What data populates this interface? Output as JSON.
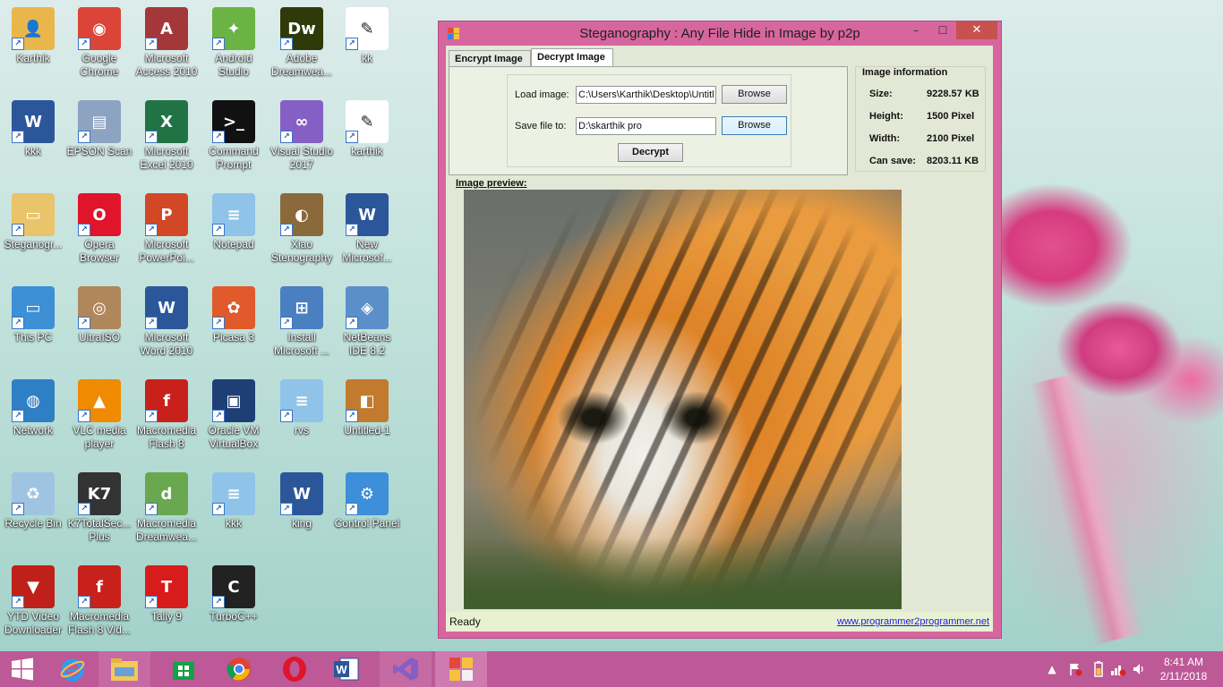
{
  "desktop": {
    "icons": [
      {
        "label": "Karthik",
        "icon": "user-folder-icon",
        "color": "#e9b64b"
      },
      {
        "label": "Google Chrome",
        "icon": "chrome-icon",
        "color": "#db4437"
      },
      {
        "label": "Microsoft Access 2010",
        "icon": "access-icon",
        "color": "#a4373a"
      },
      {
        "label": "Android Studio",
        "icon": "android-studio-icon",
        "color": "#6ab344"
      },
      {
        "label": "Adobe Dreamwea...",
        "icon": "dreamweaver-icon",
        "color": "#2f3a0a"
      },
      {
        "label": "kk",
        "icon": "image-file-icon",
        "color": "#ffffff"
      },
      {
        "label": "kkk",
        "icon": "word-doc-icon",
        "color": "#2b579a"
      },
      {
        "label": "EPSON Scan",
        "icon": "scanner-icon",
        "color": "#8da3c2"
      },
      {
        "label": "Microsoft Excel 2010",
        "icon": "excel-icon",
        "color": "#217346"
      },
      {
        "label": "Command Prompt",
        "icon": "command-prompt-icon",
        "color": "#111111"
      },
      {
        "label": "Visual Studio 2017",
        "icon": "visual-studio-icon",
        "color": "#865fc5"
      },
      {
        "label": "karthik",
        "icon": "image-file-icon",
        "color": "#ffffff"
      },
      {
        "label": "Steganogr...",
        "icon": "folder-icon",
        "color": "#e9c46a"
      },
      {
        "label": "Opera Browser",
        "icon": "opera-icon",
        "color": "#e0142a"
      },
      {
        "label": "Microsoft PowerPoi...",
        "icon": "powerpoint-icon",
        "color": "#d24726"
      },
      {
        "label": "Notepad",
        "icon": "notepad-icon",
        "color": "#8fc3e8"
      },
      {
        "label": "Xiao Stenography",
        "icon": "xiao-steg-icon",
        "color": "#8a6a3a"
      },
      {
        "label": "New Microsof...",
        "icon": "word-doc-icon",
        "color": "#2b579a"
      },
      {
        "label": "This PC",
        "icon": "computer-icon",
        "color": "#3d8fd6"
      },
      {
        "label": "UltraISO",
        "icon": "disc-icon",
        "color": "#b0875a"
      },
      {
        "label": "Microsoft Word 2010",
        "icon": "word-icon",
        "color": "#2b579a"
      },
      {
        "label": "Picasa 3",
        "icon": "picasa-icon",
        "color": "#e05a2b"
      },
      {
        "label": "Install Microsoft ...",
        "icon": "installer-icon",
        "color": "#4a7fc1"
      },
      {
        "label": "NetBeans IDE 8.2",
        "icon": "netbeans-icon",
        "color": "#5a8fc9"
      },
      {
        "label": "Network",
        "icon": "network-icon",
        "color": "#2f7fc5"
      },
      {
        "label": "VLC media player",
        "icon": "vlc-icon",
        "color": "#f08a00"
      },
      {
        "label": "Macromedia Flash 8",
        "icon": "flash-icon",
        "color": "#c8201a"
      },
      {
        "label": "Oracle VM VirtualBox",
        "icon": "virtualbox-icon",
        "color": "#1e3f75"
      },
      {
        "label": "rvs",
        "icon": "notepad-icon",
        "color": "#8fc3e8"
      },
      {
        "label": "Untitled-1",
        "icon": "tiger-image-icon",
        "color": "#c27a2e"
      },
      {
        "label": "Recycle Bin",
        "icon": "recycle-bin-icon",
        "color": "#9fc4e2"
      },
      {
        "label": "K7TotalSec... Plus",
        "icon": "k7-icon",
        "color": "#333333"
      },
      {
        "label": "Macromedia Dreamwea...",
        "icon": "dreamweaver8-icon",
        "color": "#6aa84f"
      },
      {
        "label": "kkk",
        "icon": "notepad-icon",
        "color": "#8fc3e8"
      },
      {
        "label": "king",
        "icon": "word-doc-icon",
        "color": "#2b579a"
      },
      {
        "label": "Control Panel",
        "icon": "control-panel-icon",
        "color": "#3c8fd8"
      },
      {
        "label": "YTD Video Downloader",
        "icon": "ytd-icon",
        "color": "#c0201a"
      },
      {
        "label": "Macromedia Flash 8 Vid...",
        "icon": "flash-video-icon",
        "color": "#c8201a"
      },
      {
        "label": "Tally 9",
        "icon": "tally-icon",
        "color": "#d81b1b"
      },
      {
        "label": "TurboC++",
        "icon": "turboc-icon",
        "color": "#222222"
      }
    ]
  },
  "window": {
    "title": "Steganography : Any File Hide in Image by p2p",
    "minimize": "–",
    "maximize": "☐",
    "close": "✕",
    "tabs": [
      "Encrypt Image",
      "Decrypt Image"
    ],
    "load_label": "Load image:",
    "load_value": "C:\\Users\\Karthik\\Desktop\\Untitl",
    "save_label": "Save file to:",
    "save_value": "D:\\skarthik  pro",
    "browse_1": "Browse",
    "browse_2": "Browse",
    "decrypt_button": "Decrypt",
    "info_title": "Image information",
    "info": [
      {
        "key": "Size:",
        "value": "9228.57 KB"
      },
      {
        "key": "Height:",
        "value": "1500 Pixel"
      },
      {
        "key": "Width:",
        "value": "2100 Pixel"
      },
      {
        "key": "Can save:",
        "value": "8203.11 KB"
      }
    ],
    "preview_label": "Image preview:",
    "status": "Ready",
    "link": "www.programmer2programmer.net"
  },
  "taskbar": {
    "apps": [
      "start-icon",
      "internet-explorer-icon",
      "file-explorer-icon",
      "store-icon",
      "chrome-icon",
      "opera-icon",
      "word-icon",
      "visual-studio-icon",
      "steganography-app-icon"
    ],
    "time": "8:41 AM",
    "date": "2/11/2018",
    "tray_up": "▲"
  },
  "colors": {
    "window_frame": "#d7669f",
    "taskbar": "#bc5996",
    "client": "#e3e8d6"
  }
}
